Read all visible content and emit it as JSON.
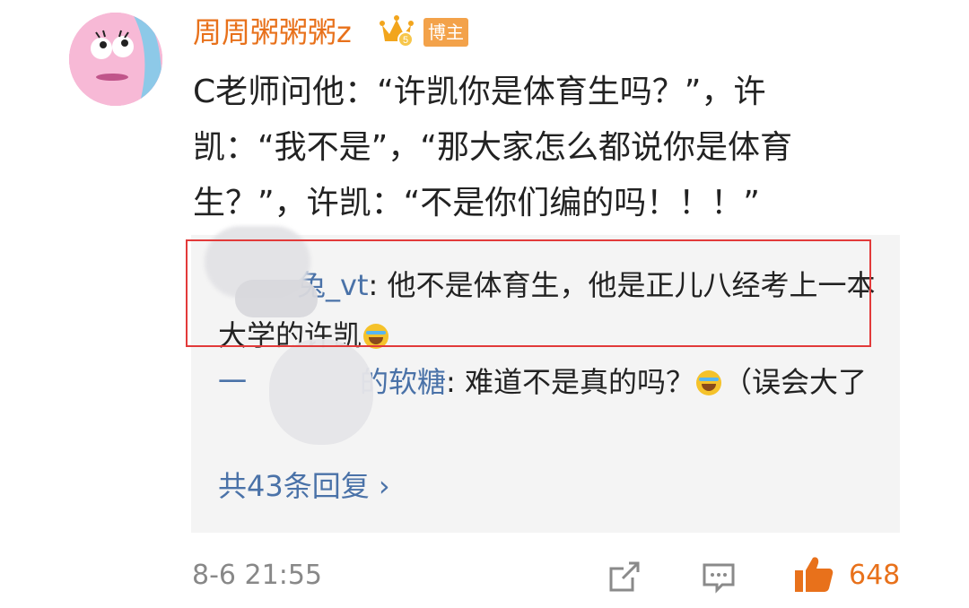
{
  "post": {
    "username": "周周粥粥粥z",
    "badge": "博主",
    "text": "C老师问他：“许凯你是体育生吗？”，许凯：“我不是”，“那大家怎么都说你是体育生？”，许凯：“不是你们编的吗！！！”"
  },
  "replies": [
    {
      "name": "兔_vt",
      "text": ": 他不是体育生，他是正儿八经考上一本大学的许凯"
    },
    {
      "name_start": "一",
      "name_end": "的软糖",
      "text": ": 难道不是真的吗？",
      "text_after": "（误会大了"
    }
  ],
  "more_replies": "共43条回复 ›",
  "footer": {
    "time": "8-6 21:55",
    "likes": "648"
  },
  "icons": [
    "avatar-icon",
    "crown-icon",
    "laugh-emoji-icon",
    "share-icon",
    "comment-icon",
    "like-icon"
  ],
  "colors": {
    "username": "#e8711b",
    "reply_name": "#4a72a8",
    "highlight": "#e23a3a",
    "likes": "#e8711b"
  }
}
